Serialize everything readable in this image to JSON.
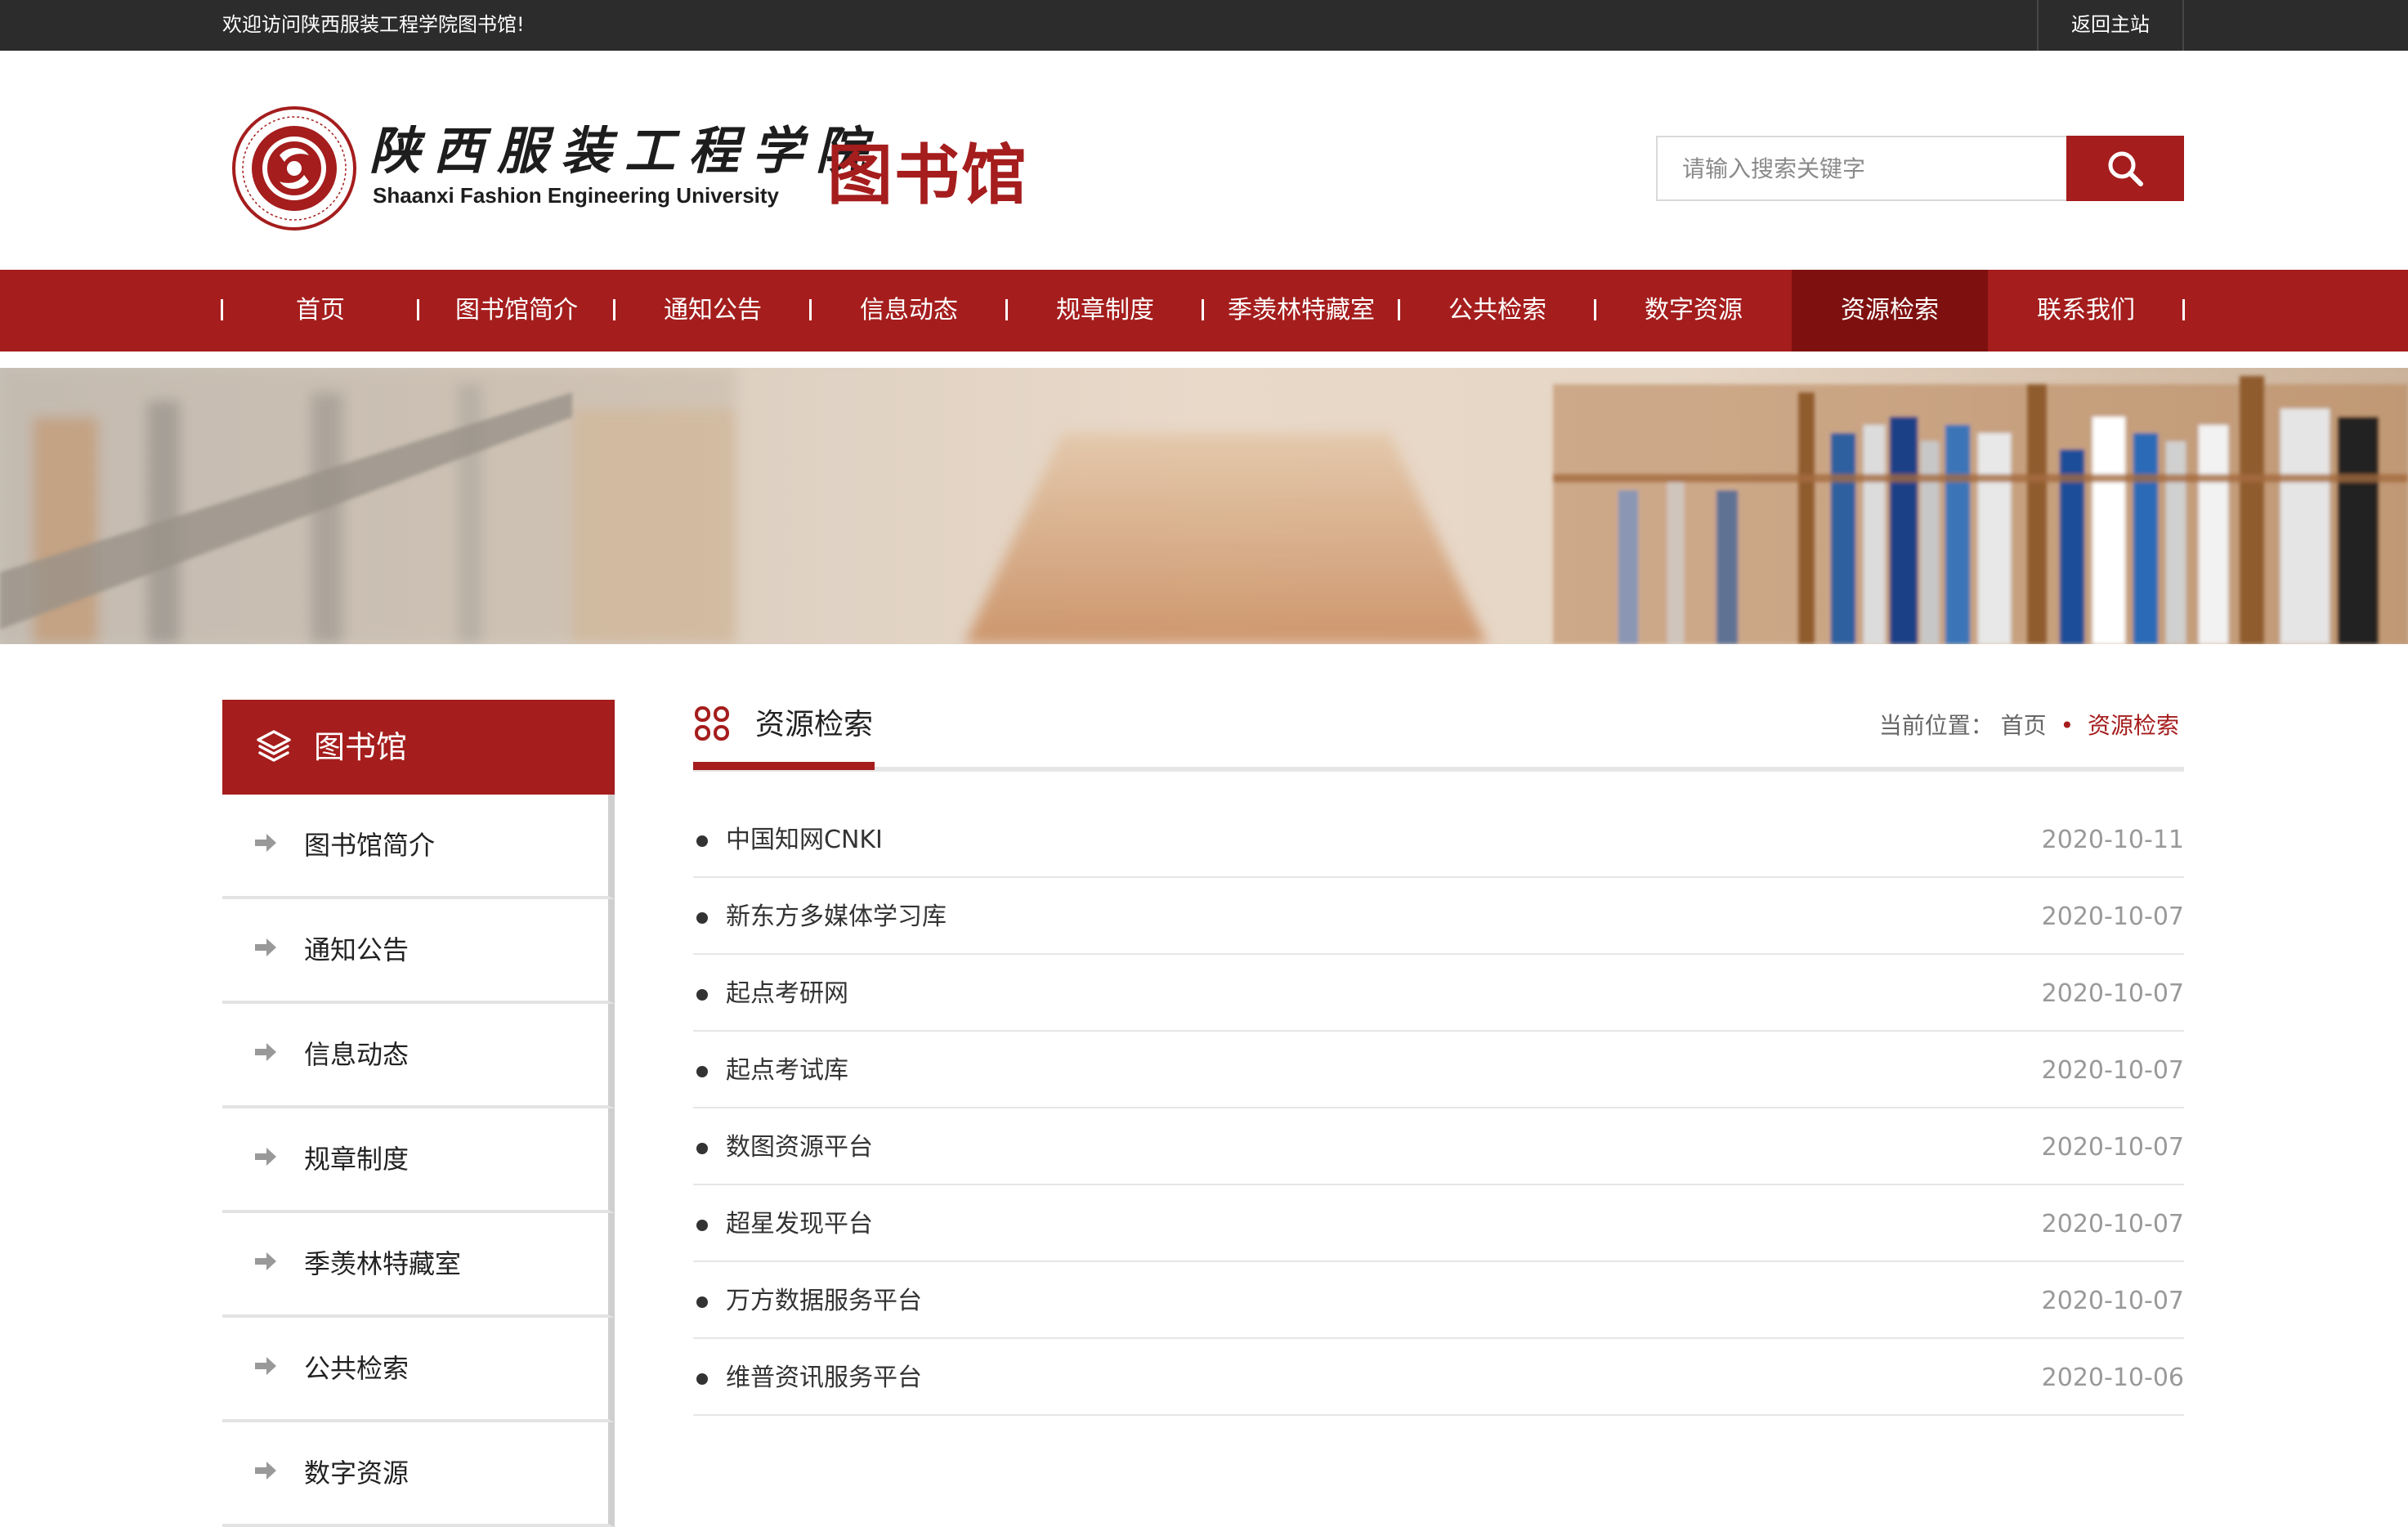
{
  "topbar": {
    "welcome": "欢迎访问陕西服装工程学院图书馆!",
    "home_link": "返回主站"
  },
  "header": {
    "school_cn": "陕西服装工程学院",
    "school_en": "Shaanxi Fashion Engineering University",
    "library_name": "图书馆",
    "seal_text": "陕西服装工程学院 SHAANXI FASHION ENGINEERING UNIVERSITY"
  },
  "search": {
    "placeholder": "请输入搜索关键字",
    "icon": "search-icon"
  },
  "nav": {
    "items": [
      {
        "label": "首页"
      },
      {
        "label": "图书馆简介"
      },
      {
        "label": "通知公告"
      },
      {
        "label": "信息动态"
      },
      {
        "label": "规章制度"
      },
      {
        "label": "季羡林特藏室"
      },
      {
        "label": "公共检索"
      },
      {
        "label": "数字资源"
      },
      {
        "label": "资源检索"
      },
      {
        "label": "联系我们"
      }
    ],
    "active_index": 8
  },
  "sidebar": {
    "title": "图书馆",
    "title_icon": "layers-icon",
    "items": [
      {
        "label": "图书馆简介"
      },
      {
        "label": "通知公告"
      },
      {
        "label": "信息动态"
      },
      {
        "label": "规章制度"
      },
      {
        "label": "季羡林特藏室"
      },
      {
        "label": "公共检索"
      },
      {
        "label": "数字资源"
      }
    ]
  },
  "main": {
    "title": "资源检索",
    "title_icon": "grid-icon",
    "breadcrumb": {
      "prefix": "当前位置：",
      "home": "首页",
      "separator": "•",
      "current": "资源检索"
    },
    "list": [
      {
        "title": "中国知网CNKI",
        "date": "2020-10-11"
      },
      {
        "title": "新东方多媒体学习库",
        "date": "2020-10-07"
      },
      {
        "title": "起点考研网",
        "date": "2020-10-07"
      },
      {
        "title": "起点考试库",
        "date": "2020-10-07"
      },
      {
        "title": "数图资源平台",
        "date": "2020-10-07"
      },
      {
        "title": "超星发现平台",
        "date": "2020-10-07"
      },
      {
        "title": "万方数据服务平台",
        "date": "2020-10-07"
      },
      {
        "title": "维普资讯服务平台",
        "date": "2020-10-06"
      }
    ]
  },
  "colors": {
    "brand": "#a51d1d",
    "brand_dark": "#7e1110",
    "topbar": "#2c2c2c"
  }
}
